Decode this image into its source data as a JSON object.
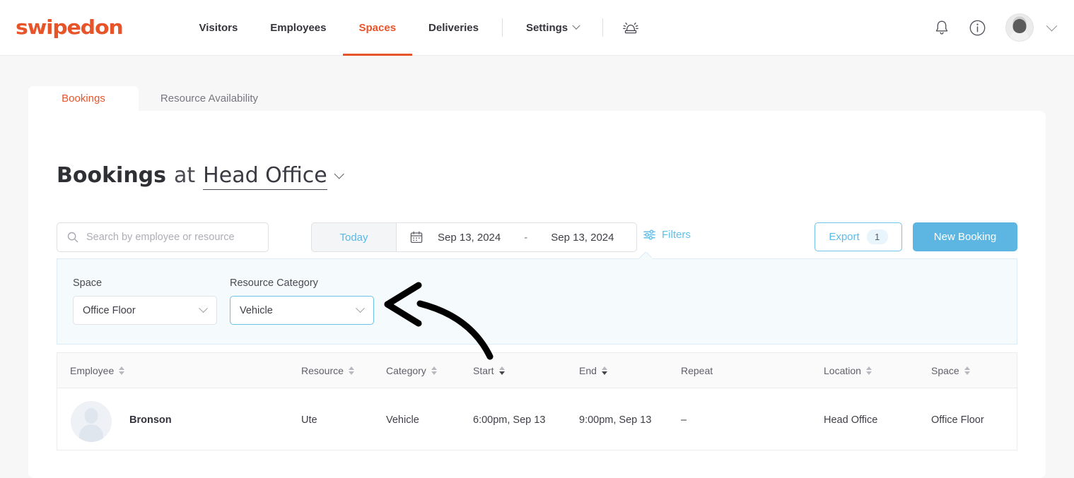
{
  "brand": {
    "logo_text": "swipedon",
    "accent_color": "#e8542a",
    "blue": "#5db6e2"
  },
  "topnav": {
    "items": [
      {
        "label": "Visitors",
        "active": false
      },
      {
        "label": "Employees",
        "active": false
      },
      {
        "label": "Spaces",
        "active": true
      },
      {
        "label": "Deliveries",
        "active": false
      },
      {
        "label": "Settings",
        "active": false
      }
    ],
    "icons": {
      "siren": "siren-icon",
      "notifications": "bell-icon",
      "info": "info-icon",
      "avatar": "user-avatar",
      "account_chevron": "chevron-down-icon"
    }
  },
  "tabs": [
    {
      "label": "Bookings",
      "active": true
    },
    {
      "label": "Resource Availability",
      "active": false
    }
  ],
  "page_title": {
    "bold": "Bookings",
    "connector": "at",
    "location": "Head Office"
  },
  "toolbar": {
    "search": {
      "value": "",
      "placeholder": "Search by employee or resource"
    },
    "today_label": "Today",
    "date_start": "Sep 13, 2024",
    "date_separator": "-",
    "date_end": "Sep 13, 2024",
    "filters_label": "Filters",
    "export_label": "Export",
    "export_count": "1",
    "new_booking_label": "New Booking"
  },
  "filter_panel": {
    "space": {
      "label": "Space",
      "value": "Office Floor"
    },
    "resource_category": {
      "label": "Resource Category",
      "value": "Vehicle"
    }
  },
  "table": {
    "columns": [
      {
        "label": "Employee",
        "sortable": true
      },
      {
        "label": "Resource",
        "sortable": true
      },
      {
        "label": "Category",
        "sortable": true
      },
      {
        "label": "Start",
        "sortable": true
      },
      {
        "label": "End",
        "sortable": true
      },
      {
        "label": "Repeat",
        "sortable": false
      },
      {
        "label": "Location",
        "sortable": true
      },
      {
        "label": "Space",
        "sortable": true
      }
    ],
    "rows": [
      {
        "employee": "Bronson",
        "resource": "Ute",
        "category": "Vehicle",
        "start": "6:00pm, Sep 13",
        "end": "9:00pm, Sep 13",
        "repeat": "–",
        "location": "Head Office",
        "space": "Office Floor"
      }
    ]
  },
  "annotation": {
    "type": "curved-arrow",
    "color": "#000000",
    "points_to": "resource-category-select"
  }
}
